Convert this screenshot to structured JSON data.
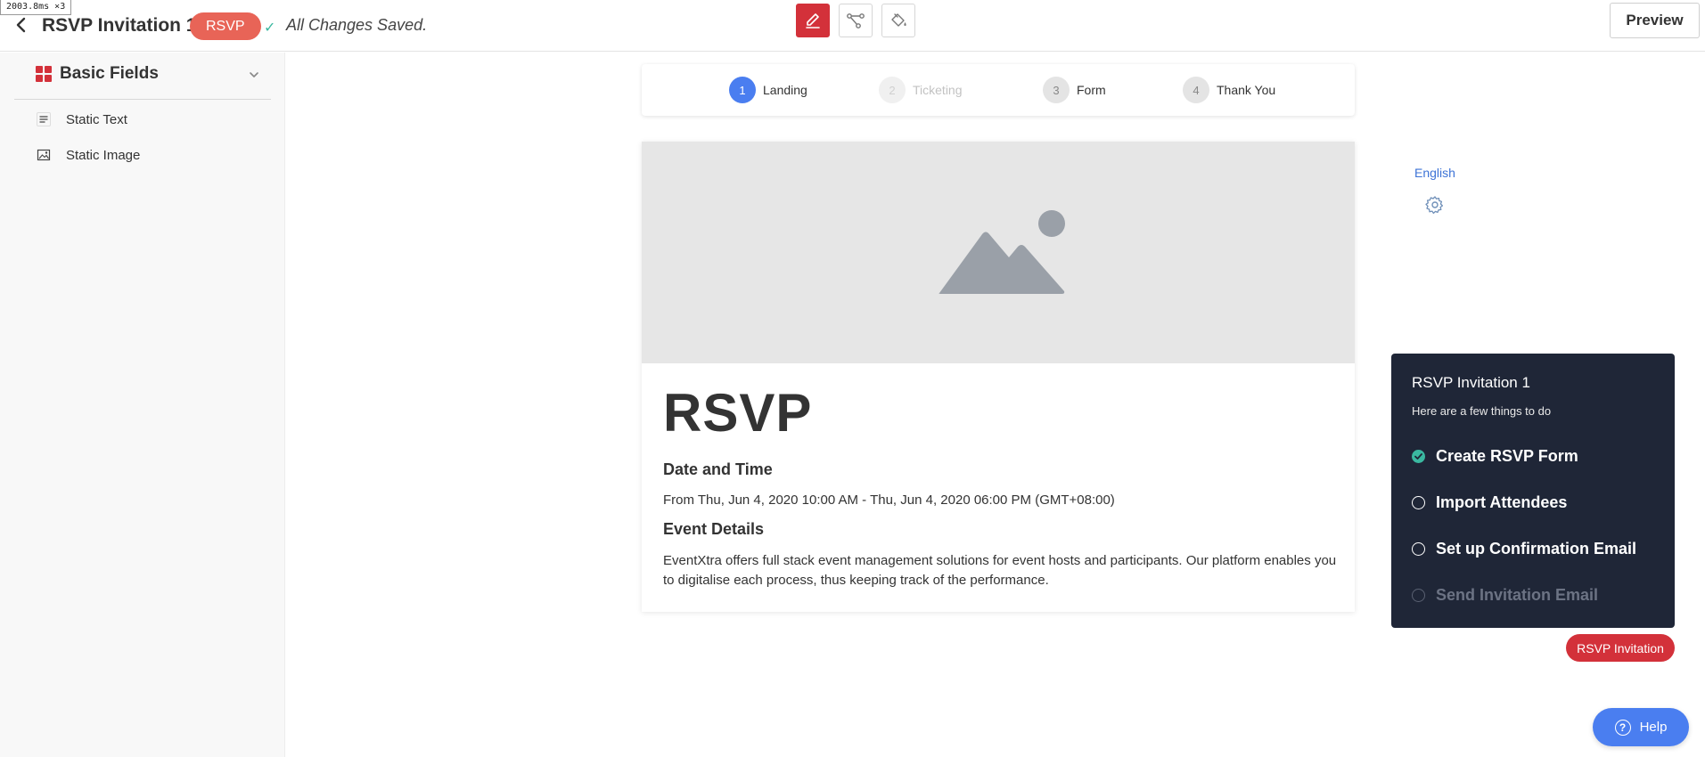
{
  "debug": {
    "label": "2003.8ms ×3"
  },
  "header": {
    "title": "RSVP Invitation 1",
    "type_badge": "RSVP",
    "save_status": "All Changes Saved.",
    "preview_label": "Preview",
    "tools": [
      {
        "icon": "pencil-icon",
        "active": true
      },
      {
        "icon": "flow-icon",
        "active": false
      },
      {
        "icon": "paint-bucket-icon",
        "active": false
      }
    ]
  },
  "sidebar": {
    "section_title": "Basic Fields",
    "items": [
      {
        "label": "Static Text",
        "icon": "text-lines-icon"
      },
      {
        "label": "Static Image",
        "icon": "image-icon"
      }
    ]
  },
  "stepper": {
    "steps": [
      {
        "number": "1",
        "label": "Landing",
        "state": "current"
      },
      {
        "number": "2",
        "label": "Ticketing",
        "state": "disabled"
      },
      {
        "number": "3",
        "label": "Form",
        "state": "pending"
      },
      {
        "number": "4",
        "label": "Thank You",
        "state": "pending"
      }
    ]
  },
  "card": {
    "heading": "RSVP",
    "date_heading": "Date and Time",
    "date_value": "From Thu, Jun 4, 2020 10:00 AM - Thu, Jun 4, 2020 06:00 PM (GMT+08:00)",
    "details_heading": "Event Details",
    "details_value": "EventXtra offers full stack event management solutions for event hosts and participants. Our platform enables you to digitalise each process, thus keeping track of the performance."
  },
  "language": {
    "label": "English"
  },
  "checklist": {
    "title": "RSVP Invitation 1",
    "subtitle": "Here are a few things to do",
    "items": [
      {
        "label": "Create RSVP Form",
        "state": "done"
      },
      {
        "label": "Import Attendees",
        "state": "open"
      },
      {
        "label": "Set up Confirmation Email",
        "state": "open"
      },
      {
        "label": "Send Invitation Email",
        "state": "disabled"
      }
    ]
  },
  "checklist_badge": {
    "label": "RSVP Invitation"
  },
  "help": {
    "label": "Help"
  },
  "colors": {
    "accent_red": "#d3313a",
    "badge_coral": "#e86457",
    "primary_blue": "#4a7ef0",
    "success_teal": "#3ab8a0",
    "panel_navy": "#1f2637"
  }
}
